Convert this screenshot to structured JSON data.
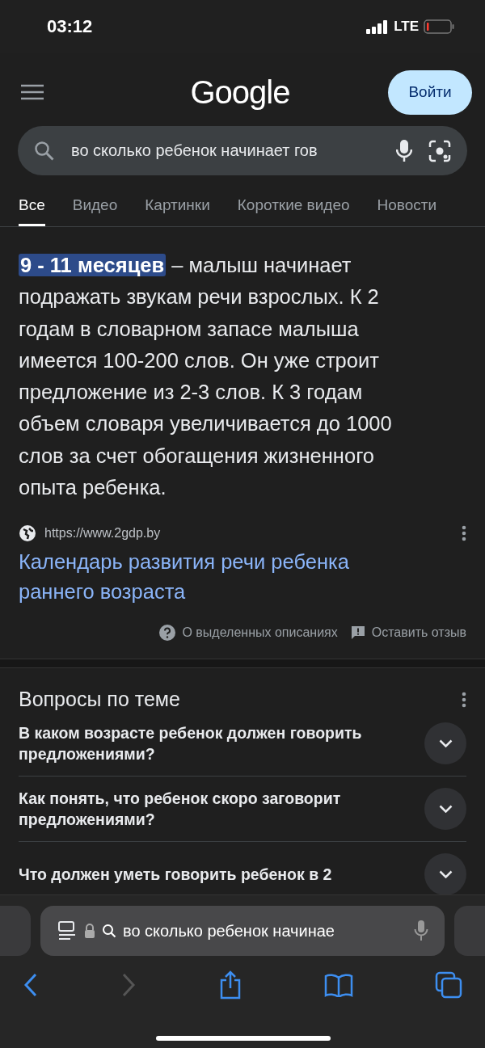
{
  "status_bar": {
    "time": "03:12",
    "network": "LTE"
  },
  "header": {
    "logo": "Google",
    "sign_in": "Войти"
  },
  "search": {
    "value": "во сколько ребенок начинает гов"
  },
  "tabs": [
    {
      "label": "Все",
      "selected": true
    },
    {
      "label": "Видео",
      "selected": false
    },
    {
      "label": "Картинки",
      "selected": false
    },
    {
      "label": "Короткие видео",
      "selected": false
    },
    {
      "label": "Новости",
      "selected": false
    }
  ],
  "answer": {
    "highlight": "9 - 11 месяцев",
    "text": " – малыш начинает подражать звукам речи взрослых. К 2 годам в словарном запасе малыша имеется 100-200 слов. Он уже строит предложение из 2-3 слов. К 3 годам объем словаря увеличивается до 1000 слов за счет обогащения жизненного опыта ребенка.",
    "source_url": "https://www.2gdp.by",
    "title": "Календарь развития речи ребенка раннего возраста",
    "about": "О выделенных описаниях",
    "feedback": "Оставить отзыв"
  },
  "related": {
    "title": "Вопросы по теме",
    "questions": [
      {
        "text": "В каком возрасте ребенок должен говорить предложениями?",
        "expanded": false
      },
      {
        "text": "Как понять, что ребенок скоро заговорит предложениями?",
        "expanded": false
      },
      {
        "text": "Что должен уметь говорить ребенок в 2",
        "expanded": false
      }
    ]
  },
  "browser_bar": {
    "address": "во сколько ребенок начинае"
  }
}
